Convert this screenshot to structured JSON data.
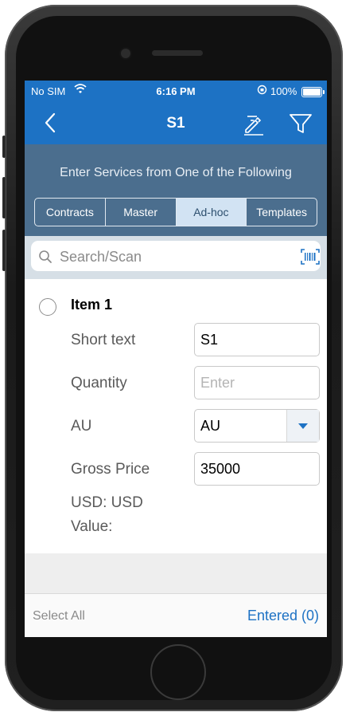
{
  "status_bar": {
    "carrier": "No SIM",
    "time": "6:16 PM",
    "battery": "100%"
  },
  "nav": {
    "title": "S1",
    "icons": [
      "back-chevron-icon",
      "edit-signature-icon",
      "filter-icon"
    ]
  },
  "header": {
    "prompt": "Enter Services from One of the Following",
    "segments": [
      "Contracts",
      "Master",
      "Ad-hoc",
      "Templates"
    ],
    "selected_segment": "Ad-hoc"
  },
  "search": {
    "placeholder": "Search/Scan",
    "icons": [
      "search-icon",
      "barcode-scan-icon"
    ]
  },
  "item": {
    "title": "Item 1",
    "fields": {
      "short_text": {
        "label": "Short text",
        "value": "S1"
      },
      "quantity": {
        "label": "Quantity",
        "placeholder": "Enter"
      },
      "au": {
        "label": "AU",
        "value": "AU"
      },
      "gross_price": {
        "label": "Gross Price",
        "value": "35000"
      },
      "usd_value": {
        "label_line1": "USD: USD",
        "label_line2": "Value:"
      }
    }
  },
  "footer": {
    "select_all": "Select All",
    "entered": "Entered (0)"
  },
  "colors": {
    "primary_blue": "#1d72c4",
    "header_slate": "#4b6e8e",
    "active_segment": "#d2e3f3"
  }
}
